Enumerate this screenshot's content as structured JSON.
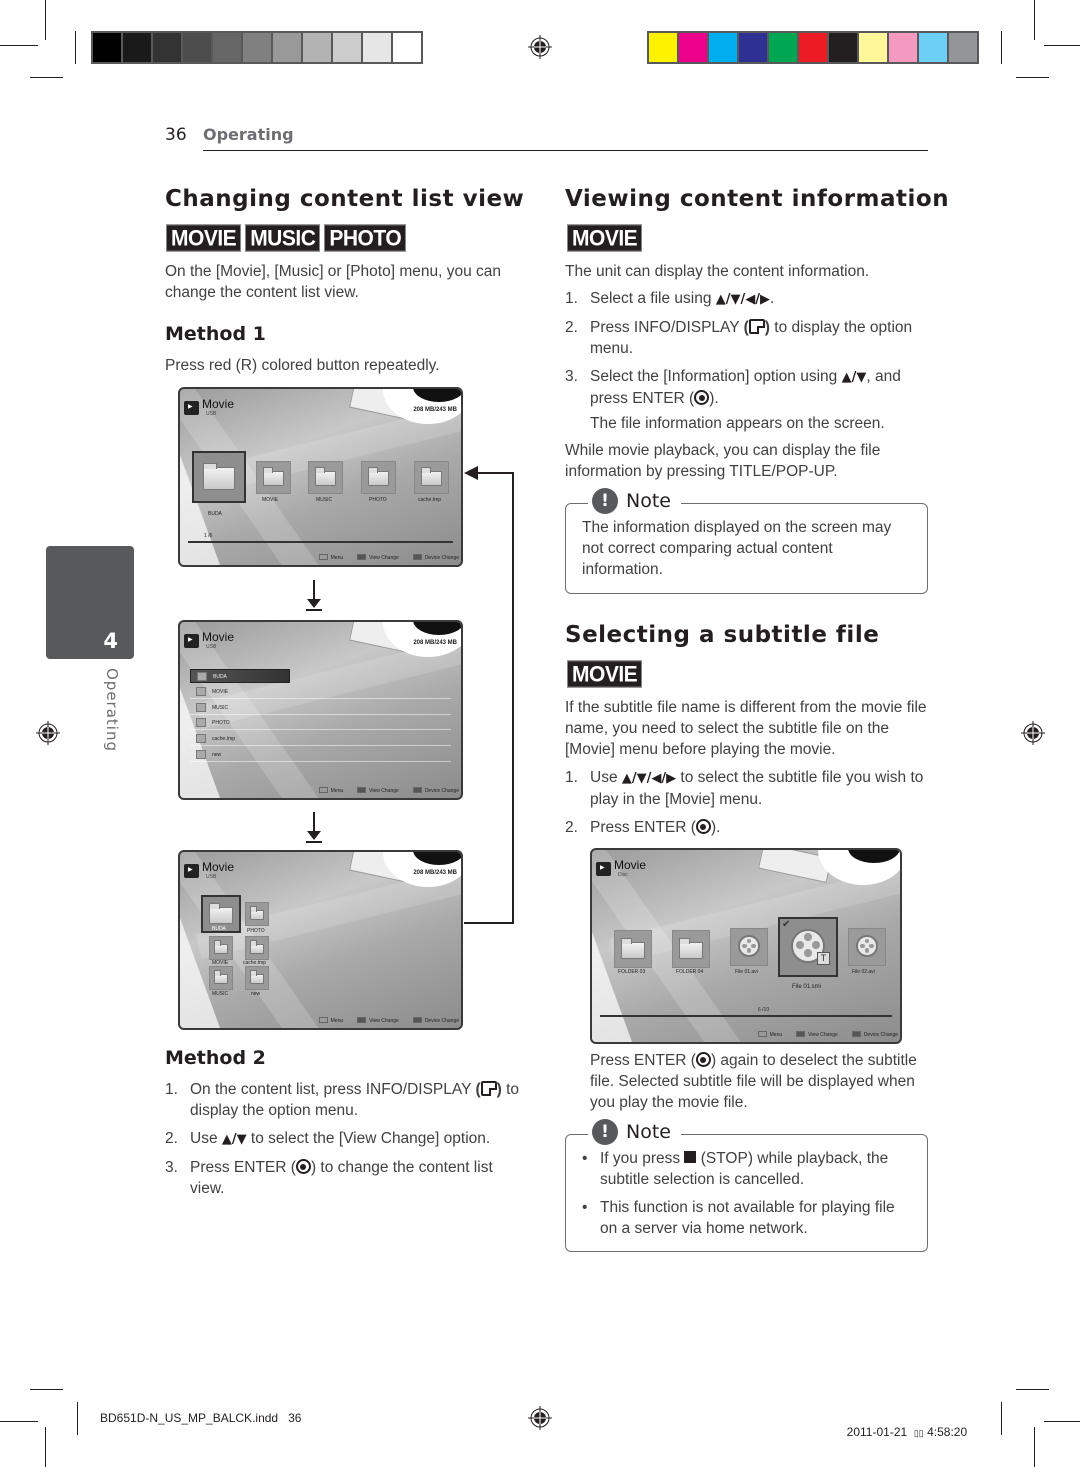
{
  "print_marks": {
    "grayscale_bar": [
      "#000000",
      "#1a1a1a",
      "#333333",
      "#4d4d4d",
      "#666666",
      "#808080",
      "#999999",
      "#b3b3b3",
      "#cccccc",
      "#e6e6e6",
      "#ffffff"
    ],
    "color_bar": [
      "#fff200",
      "#ec008c",
      "#00aeef",
      "#2e3192",
      "#00a651",
      "#ed1c24",
      "#231f20",
      "#fff799",
      "#f49ac1",
      "#6dcff6",
      "#939598"
    ],
    "slug_file": "BD651D-N_US_MP_BALCK.indd   36",
    "slug_date": "2011-01-21",
    "slug_time_glyph": "▯▯",
    "slug_time": "4:58:20"
  },
  "header": {
    "page_number": "36",
    "section": "Operating"
  },
  "side_tab": {
    "chapter": "4",
    "label": "Operating"
  },
  "left": {
    "title": "Changing content list view",
    "badges": [
      "MOVIE",
      "MUSIC",
      "PHOTO"
    ],
    "intro": "On the [Movie], [Music] or [Photo] menu, you can change the content list view.",
    "method1": {
      "heading": "Method 1",
      "text": "Press red (R) colored button repeatedly."
    },
    "screens": [
      {
        "view": "thumbnail-row",
        "app_title": "Movie",
        "source": "USB",
        "capacity": "208 MB/243 MB",
        "selected_label": "BUDA",
        "items": [
          "MOVIE",
          "MUSIC",
          "PHOTO",
          "cache.tmp"
        ],
        "counter": "1 /6",
        "footer": [
          "Menu",
          "View Change",
          "Device Change"
        ]
      },
      {
        "view": "list",
        "app_title": "Movie",
        "source": "USB",
        "capacity": "208 MB/243 MB",
        "items": [
          "BUDA",
          "MOVIE",
          "MUSIC",
          "PHOTO",
          "cache.tmp",
          "new"
        ],
        "footer": [
          "Menu",
          "View Change",
          "Device Change"
        ]
      },
      {
        "view": "grid",
        "app_title": "Movie",
        "source": "USB",
        "capacity": "208 MB/243 MB",
        "items": [
          "BUDA",
          "PHOTO",
          "MOVIE",
          "cache.tmp",
          "MUSIC",
          "new"
        ],
        "footer": [
          "Menu",
          "View Change",
          "Device Change"
        ]
      }
    ],
    "method2": {
      "heading": "Method 2",
      "steps": [
        {
          "n": "1.",
          "a": "On the content list, press INFO/DISPLAY ",
          "b": " to display the option menu."
        },
        {
          "n": "2.",
          "a": "Use ",
          "sym": "▲/▼",
          "b": " to select the [View Change] option."
        },
        {
          "n": "3.",
          "a": "Press ENTER (",
          "b": ") to change the content list view."
        }
      ]
    }
  },
  "right": {
    "info": {
      "title": "Viewing content information",
      "badge": "MOVIE",
      "intro": "The unit can display the content information.",
      "steps": [
        {
          "n": "1.",
          "a": "Select a file using ",
          "sym": "▲/▼/◀/▶",
          "b": "."
        },
        {
          "n": "2.",
          "a": "Press INFO/DISPLAY ",
          "b": " to display the option menu."
        },
        {
          "n": "3.",
          "a": "Select the [Information] option using ",
          "sym": "▲/▼",
          "b": ", and press ENTER (",
          "c": ")."
        }
      ],
      "after_step": "The file information appears on the screen.",
      "playback_text": "While movie playback, you can display the file information by pressing TITLE/POP-UP.",
      "note": {
        "title": "Note",
        "text": "The information displayed on the screen may not correct comparing actual content information."
      }
    },
    "subtitle": {
      "title": "Selecting a subtitle file",
      "badge": "MOVIE",
      "intro": "If the subtitle file name is different from the movie file name, you need to select the subtitle file on the [Movie] menu before playing the movie.",
      "steps": [
        {
          "n": "1.",
          "a": "Use ",
          "sym": "▲/▼/◀/▶",
          "b": " to select the subtitle file you wish to play in the [Movie] menu."
        },
        {
          "n": "2.",
          "a": "Press ENTER (",
          "b": ")."
        }
      ],
      "screen": {
        "app_title": "Movie",
        "source": "Disc",
        "items": [
          "FOLDER 03",
          "FOLDER 04",
          "File 01.avi",
          "File 02.avi"
        ],
        "selected_label": "File 01.smi",
        "counter": "6 /10",
        "footer": [
          "Menu",
          "View Change",
          "Device Change"
        ]
      },
      "after_text_a": "Press ENTER (",
      "after_text_b": ") again to deselect the subtitle file. Selected subtitle file will be displayed when you play the movie file.",
      "note": {
        "title": "Note",
        "items": [
          {
            "a": "If you press ",
            "b": " (STOP) while playback, the subtitle selection is cancelled."
          },
          {
            "a": "This function is not available for playing file on a server via home network."
          }
        ]
      }
    }
  }
}
